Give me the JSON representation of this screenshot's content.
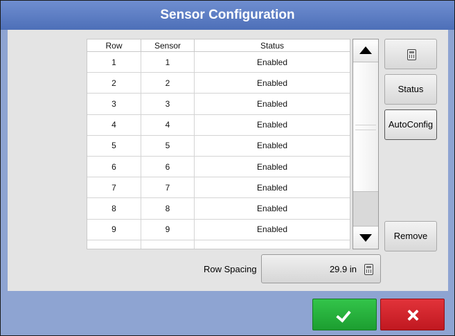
{
  "window": {
    "title": "Sensor Configuration"
  },
  "table": {
    "headers": {
      "row": "Row",
      "sensor": "Sensor",
      "status": "Status"
    },
    "rows": [
      {
        "row": "1",
        "sensor": "1",
        "status": "Enabled"
      },
      {
        "row": "2",
        "sensor": "2",
        "status": "Enabled"
      },
      {
        "row": "3",
        "sensor": "3",
        "status": "Enabled"
      },
      {
        "row": "4",
        "sensor": "4",
        "status": "Enabled"
      },
      {
        "row": "5",
        "sensor": "5",
        "status": "Enabled"
      },
      {
        "row": "6",
        "sensor": "6",
        "status": "Enabled"
      },
      {
        "row": "7",
        "sensor": "7",
        "status": "Enabled"
      },
      {
        "row": "8",
        "sensor": "8",
        "status": "Enabled"
      },
      {
        "row": "9",
        "sensor": "9",
        "status": "Enabled"
      }
    ]
  },
  "side_buttons": {
    "calculator_icon": "calculator-icon",
    "status_label": "Status",
    "autoconfig_label": "AutoConfig",
    "remove_label": "Remove"
  },
  "row_spacing": {
    "label": "Row Spacing",
    "value": "29.9 in",
    "icon": "calculator-icon"
  },
  "footer": {
    "ok_icon": "check-icon",
    "cancel_icon": "x-icon",
    "ok_color": "#26b23c",
    "cancel_color": "#d3232a"
  },
  "colors": {
    "title_bar": "#5a7cc2",
    "background": "#8ea4d2",
    "panel": "#e4e4e4"
  }
}
